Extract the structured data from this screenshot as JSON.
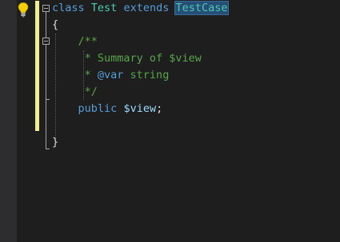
{
  "editor": {
    "lines": [
      {
        "tokens": [
          {
            "text": "class",
            "kind": "kw"
          },
          {
            "text": " ",
            "kind": "plain"
          },
          {
            "text": "Test",
            "kind": "cls"
          },
          {
            "text": " ",
            "kind": "plain"
          },
          {
            "text": "extends",
            "kind": "kw"
          },
          {
            "text": " ",
            "kind": "plain"
          },
          {
            "text": "TestCase",
            "kind": "sel"
          }
        ]
      },
      {
        "tokens": [
          {
            "text": "{",
            "kind": "plain"
          }
        ]
      },
      {
        "tokens": [
          {
            "text": "    ",
            "kind": "plain"
          },
          {
            "text": "/**",
            "kind": "cmt"
          }
        ]
      },
      {
        "tokens": [
          {
            "text": "     ",
            "kind": "plain"
          },
          {
            "text": "* Summary of $view",
            "kind": "cmt"
          }
        ]
      },
      {
        "tokens": [
          {
            "text": "     ",
            "kind": "plain"
          },
          {
            "text": "* ",
            "kind": "cmt"
          },
          {
            "text": "@var",
            "kind": "doctag"
          },
          {
            "text": " string",
            "kind": "cmt"
          }
        ]
      },
      {
        "tokens": [
          {
            "text": "     ",
            "kind": "plain"
          },
          {
            "text": "*/",
            "kind": "cmt"
          }
        ]
      },
      {
        "tokens": [
          {
            "text": "    ",
            "kind": "plain"
          },
          {
            "text": "public",
            "kind": "kw"
          },
          {
            "text": " ",
            "kind": "plain"
          },
          {
            "text": "$view",
            "kind": "var"
          },
          {
            "text": ";",
            "kind": "plain"
          }
        ]
      },
      {
        "tokens": []
      },
      {
        "tokens": [
          {
            "text": "}",
            "kind": "plain"
          }
        ]
      }
    ]
  },
  "icons": {
    "lightbulb": "lightbulb-icon",
    "collapse": "collapse-icon"
  },
  "colors": {
    "background": "#1e1e1e",
    "keyword": "#569cd6",
    "class_name": "#4ec9b0",
    "comment": "#57a64a",
    "variable": "#9cdcfe",
    "change_bar": "#efef91",
    "selection": "#264f78"
  }
}
